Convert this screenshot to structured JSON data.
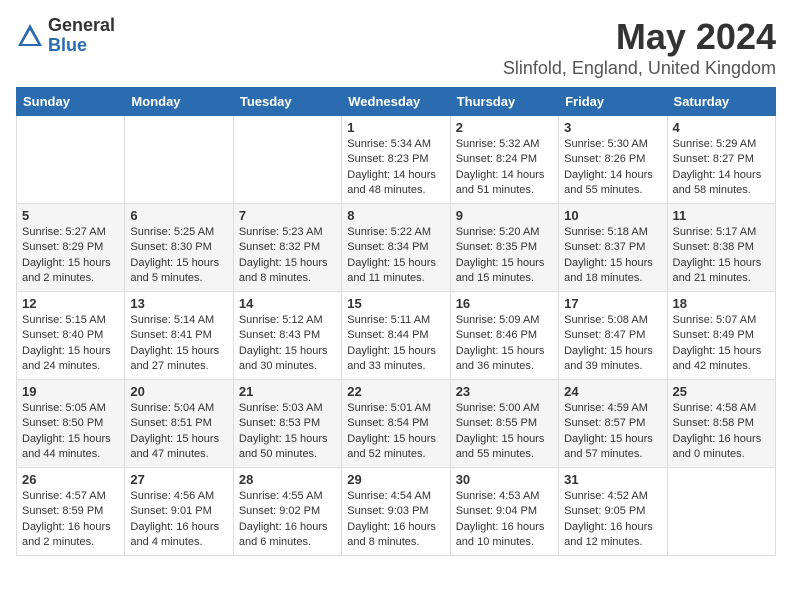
{
  "logo": {
    "general": "General",
    "blue": "Blue"
  },
  "title": "May 2024",
  "subtitle": "Slinfold, England, United Kingdom",
  "headers": [
    "Sunday",
    "Monday",
    "Tuesday",
    "Wednesday",
    "Thursday",
    "Friday",
    "Saturday"
  ],
  "weeks": [
    [
      {
        "day": "",
        "info": ""
      },
      {
        "day": "",
        "info": ""
      },
      {
        "day": "",
        "info": ""
      },
      {
        "day": "1",
        "info": "Sunrise: 5:34 AM\nSunset: 8:23 PM\nDaylight: 14 hours\nand 48 minutes."
      },
      {
        "day": "2",
        "info": "Sunrise: 5:32 AM\nSunset: 8:24 PM\nDaylight: 14 hours\nand 51 minutes."
      },
      {
        "day": "3",
        "info": "Sunrise: 5:30 AM\nSunset: 8:26 PM\nDaylight: 14 hours\nand 55 minutes."
      },
      {
        "day": "4",
        "info": "Sunrise: 5:29 AM\nSunset: 8:27 PM\nDaylight: 14 hours\nand 58 minutes."
      }
    ],
    [
      {
        "day": "5",
        "info": "Sunrise: 5:27 AM\nSunset: 8:29 PM\nDaylight: 15 hours\nand 2 minutes."
      },
      {
        "day": "6",
        "info": "Sunrise: 5:25 AM\nSunset: 8:30 PM\nDaylight: 15 hours\nand 5 minutes."
      },
      {
        "day": "7",
        "info": "Sunrise: 5:23 AM\nSunset: 8:32 PM\nDaylight: 15 hours\nand 8 minutes."
      },
      {
        "day": "8",
        "info": "Sunrise: 5:22 AM\nSunset: 8:34 PM\nDaylight: 15 hours\nand 11 minutes."
      },
      {
        "day": "9",
        "info": "Sunrise: 5:20 AM\nSunset: 8:35 PM\nDaylight: 15 hours\nand 15 minutes."
      },
      {
        "day": "10",
        "info": "Sunrise: 5:18 AM\nSunset: 8:37 PM\nDaylight: 15 hours\nand 18 minutes."
      },
      {
        "day": "11",
        "info": "Sunrise: 5:17 AM\nSunset: 8:38 PM\nDaylight: 15 hours\nand 21 minutes."
      }
    ],
    [
      {
        "day": "12",
        "info": "Sunrise: 5:15 AM\nSunset: 8:40 PM\nDaylight: 15 hours\nand 24 minutes."
      },
      {
        "day": "13",
        "info": "Sunrise: 5:14 AM\nSunset: 8:41 PM\nDaylight: 15 hours\nand 27 minutes."
      },
      {
        "day": "14",
        "info": "Sunrise: 5:12 AM\nSunset: 8:43 PM\nDaylight: 15 hours\nand 30 minutes."
      },
      {
        "day": "15",
        "info": "Sunrise: 5:11 AM\nSunset: 8:44 PM\nDaylight: 15 hours\nand 33 minutes."
      },
      {
        "day": "16",
        "info": "Sunrise: 5:09 AM\nSunset: 8:46 PM\nDaylight: 15 hours\nand 36 minutes."
      },
      {
        "day": "17",
        "info": "Sunrise: 5:08 AM\nSunset: 8:47 PM\nDaylight: 15 hours\nand 39 minutes."
      },
      {
        "day": "18",
        "info": "Sunrise: 5:07 AM\nSunset: 8:49 PM\nDaylight: 15 hours\nand 42 minutes."
      }
    ],
    [
      {
        "day": "19",
        "info": "Sunrise: 5:05 AM\nSunset: 8:50 PM\nDaylight: 15 hours\nand 44 minutes."
      },
      {
        "day": "20",
        "info": "Sunrise: 5:04 AM\nSunset: 8:51 PM\nDaylight: 15 hours\nand 47 minutes."
      },
      {
        "day": "21",
        "info": "Sunrise: 5:03 AM\nSunset: 8:53 PM\nDaylight: 15 hours\nand 50 minutes."
      },
      {
        "day": "22",
        "info": "Sunrise: 5:01 AM\nSunset: 8:54 PM\nDaylight: 15 hours\nand 52 minutes."
      },
      {
        "day": "23",
        "info": "Sunrise: 5:00 AM\nSunset: 8:55 PM\nDaylight: 15 hours\nand 55 minutes."
      },
      {
        "day": "24",
        "info": "Sunrise: 4:59 AM\nSunset: 8:57 PM\nDaylight: 15 hours\nand 57 minutes."
      },
      {
        "day": "25",
        "info": "Sunrise: 4:58 AM\nSunset: 8:58 PM\nDaylight: 16 hours\nand 0 minutes."
      }
    ],
    [
      {
        "day": "26",
        "info": "Sunrise: 4:57 AM\nSunset: 8:59 PM\nDaylight: 16 hours\nand 2 minutes."
      },
      {
        "day": "27",
        "info": "Sunrise: 4:56 AM\nSunset: 9:01 PM\nDaylight: 16 hours\nand 4 minutes."
      },
      {
        "day": "28",
        "info": "Sunrise: 4:55 AM\nSunset: 9:02 PM\nDaylight: 16 hours\nand 6 minutes."
      },
      {
        "day": "29",
        "info": "Sunrise: 4:54 AM\nSunset: 9:03 PM\nDaylight: 16 hours\nand 8 minutes."
      },
      {
        "day": "30",
        "info": "Sunrise: 4:53 AM\nSunset: 9:04 PM\nDaylight: 16 hours\nand 10 minutes."
      },
      {
        "day": "31",
        "info": "Sunrise: 4:52 AM\nSunset: 9:05 PM\nDaylight: 16 hours\nand 12 minutes."
      },
      {
        "day": "",
        "info": ""
      }
    ]
  ]
}
